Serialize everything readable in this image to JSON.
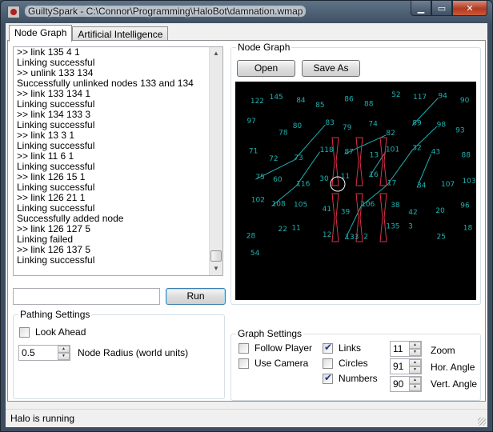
{
  "window": {
    "title": "GuiltySpark - C:\\Connor\\Programming\\HaloBot\\damnation.wmap",
    "min_glyph": "▁",
    "max_glyph": "▭",
    "close_glyph": "✕"
  },
  "tabs": [
    {
      "label": "Node Graph",
      "active": true
    },
    {
      "label": "Artificial Intelligence",
      "active": false
    }
  ],
  "console": {
    "lines": [
      ">> link 135 4 1",
      "Linking successful",
      ">> unlink 133 134",
      "Successfully unlinked nodes 133 and 134",
      ">> link 133 134 1",
      "Linking successful",
      ">> link 134 133 3",
      "Linking successful",
      ">> link 13 3 1",
      "Linking successful",
      ">> link 11 6 1",
      "Linking successful",
      ">> link 126 15 1",
      "Linking successful",
      ">> link 126 21 1",
      "Linking successful",
      "Successfully added node",
      ">> link 126 127 5",
      "Linking failed",
      ">> link 126 137 5",
      "Linking successful"
    ],
    "input_value": "",
    "run_label": "Run"
  },
  "pathing_settings": {
    "title": "Pathing Settings",
    "look_ahead_label": "Look Ahead",
    "look_ahead_checked": false,
    "node_radius_value": "0.5",
    "node_radius_label": "Node Radius (world units)"
  },
  "node_graph": {
    "title": "Node Graph",
    "open_label": "Open",
    "save_as_label": "Save As",
    "node_labels": [
      "122",
      "145",
      "84",
      "85",
      "86",
      "88",
      "52",
      "117",
      "94",
      "90",
      "97",
      "78",
      "80",
      "83",
      "79",
      "74",
      "82",
      "89",
      "98",
      "93",
      "71",
      "72",
      "73",
      "118",
      "87",
      "13",
      "101",
      "32",
      "43",
      "88",
      "75",
      "60",
      "116",
      "30",
      "11",
      "16",
      "17",
      "34",
      "107",
      "103",
      "102",
      "108",
      "105",
      "41",
      "39",
      "106",
      "38",
      "42",
      "20",
      "96",
      "28",
      "22",
      "11",
      "12",
      "133",
      "2",
      "135",
      "3",
      "25",
      "18",
      "54"
    ],
    "highlight_color": "#ffffff",
    "node_color": "#21b0b0",
    "link_color": "#e0304a"
  },
  "graph_settings": {
    "title": "Graph Settings",
    "follow_player_label": "Follow Player",
    "follow_player_checked": false,
    "use_camera_label": "Use Camera",
    "use_camera_checked": false,
    "links_label": "Links",
    "links_checked": true,
    "circles_label": "Circles",
    "circles_checked": false,
    "numbers_label": "Numbers",
    "numbers_checked": true,
    "zoom_value": "11",
    "zoom_label": "Zoom",
    "hor_angle_value": "91",
    "hor_angle_label": "Hor. Angle",
    "vert_angle_value": "90",
    "vert_angle_label": "Vert. Angle"
  },
  "status": {
    "text": "Halo is running"
  }
}
